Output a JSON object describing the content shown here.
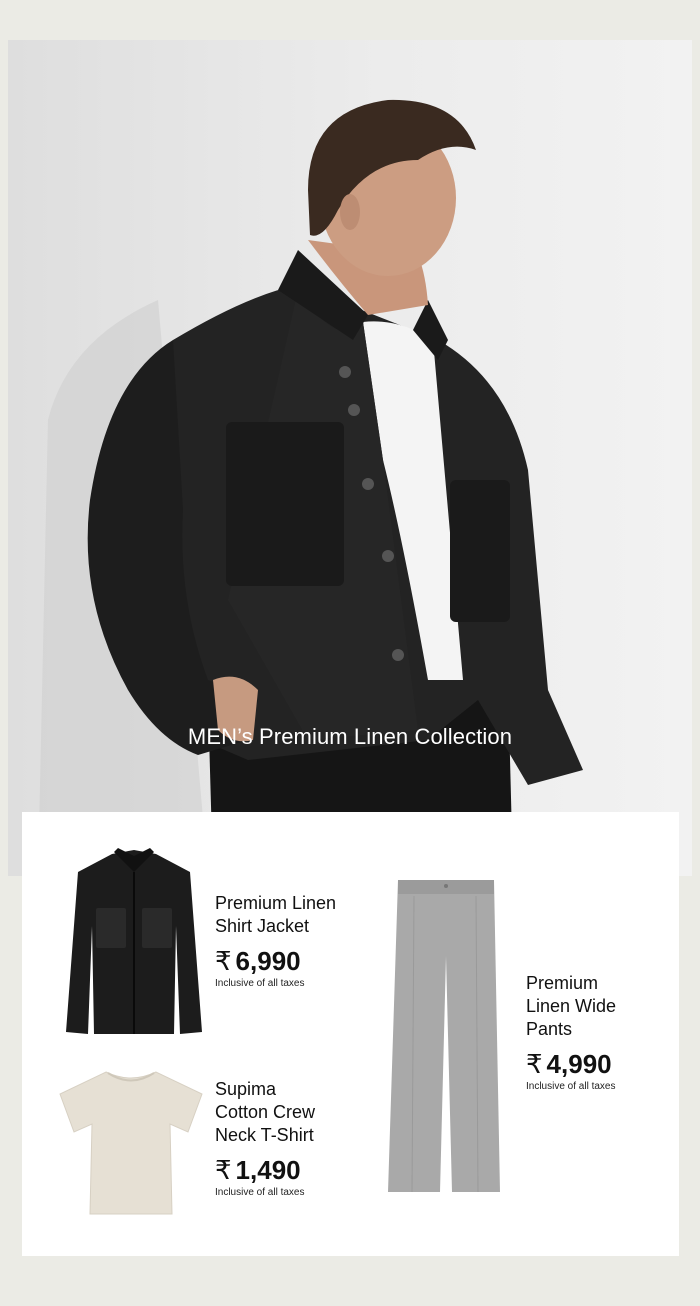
{
  "hero": {
    "caption": "MEN’s Premium Linen Collection"
  },
  "products": [
    {
      "name_line1": "Premium Linen",
      "name_line2": "Shirt Jacket",
      "currency": "₹",
      "price": "6,990",
      "tax_note": "Inclusive of all taxes",
      "color": "#1c1c1c"
    },
    {
      "name_line1": "Supima",
      "name_line2": "Cotton Crew",
      "name_line3": "Neck T-Shirt",
      "currency": "₹",
      "price": "1,490",
      "tax_note": "Inclusive of all taxes",
      "color": "#e6e0d4"
    },
    {
      "name_line1": "Premium",
      "name_line2": "Linen Wide",
      "name_line3": "Pants",
      "currency": "₹",
      "price": "4,990",
      "tax_note": "Inclusive of all taxes",
      "color": "#a9a9a9"
    }
  ]
}
